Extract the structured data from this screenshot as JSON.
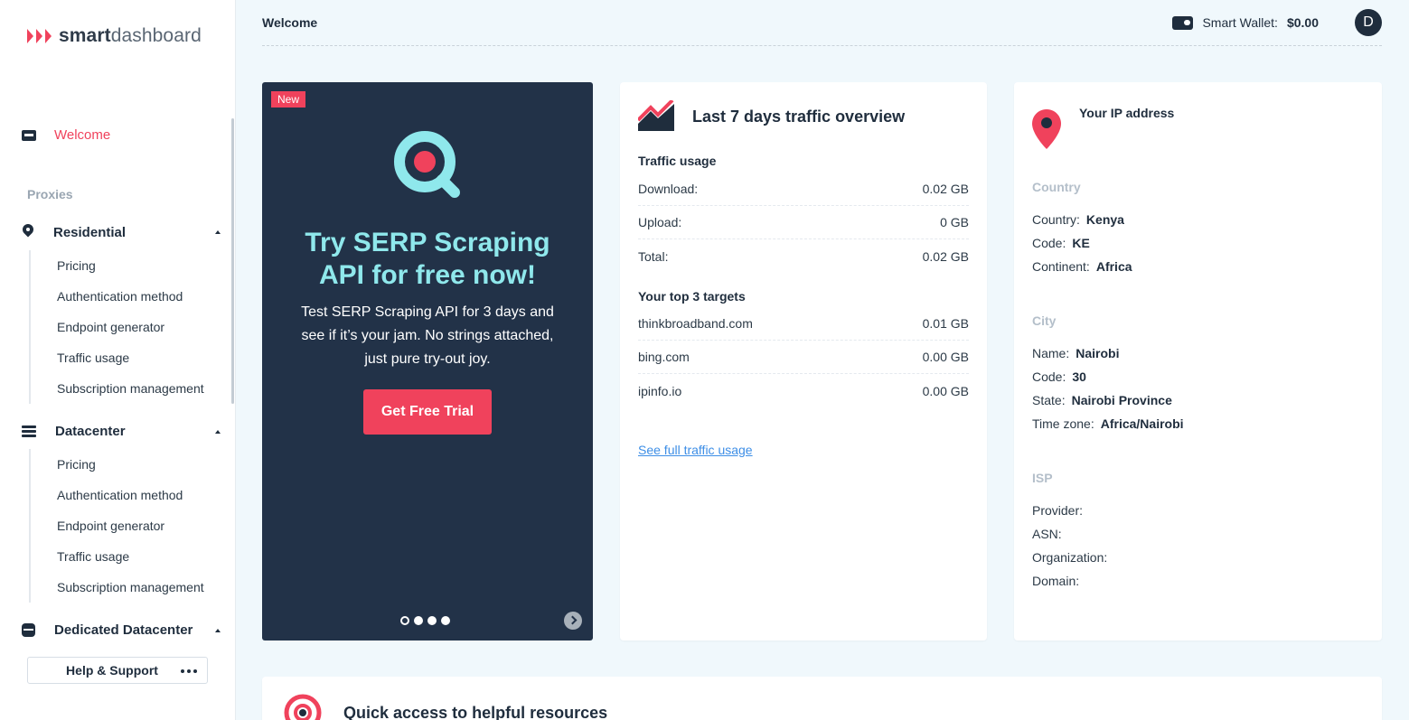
{
  "brand": {
    "logo_bold": "smart",
    "logo_light": "dashboard",
    "accent": "#f0425c",
    "dark": "#223248"
  },
  "sidebar": {
    "welcome": "Welcome",
    "section_title": "Proxies",
    "groups": [
      {
        "label": "Residential",
        "icon": "map-pin-icon",
        "items": [
          "Pricing",
          "Authentication method",
          "Endpoint generator",
          "Traffic usage",
          "Subscription management"
        ]
      },
      {
        "label": "Datacenter",
        "icon": "server-icon",
        "items": [
          "Pricing",
          "Authentication method",
          "Endpoint generator",
          "Traffic usage",
          "Subscription management"
        ]
      },
      {
        "label": "Dedicated Datacenter",
        "icon": "database-icon",
        "items": []
      }
    ],
    "help_label": "Help & Support"
  },
  "header": {
    "title": "Welcome",
    "wallet_label": "Smart Wallet:",
    "wallet_amount": "$0.00",
    "avatar_initial": "D"
  },
  "promo": {
    "badge": "New",
    "title": "Try SERP Scraping API for free now!",
    "text": "Test SERP Scraping API for 3 days and see if it’s your jam. No strings attached, just pure try-out joy.",
    "button": "Get Free Trial",
    "slides": 4,
    "active_slide": 0
  },
  "traffic": {
    "title": "Last 7 days traffic overview",
    "usage_heading": "Traffic usage",
    "usage": [
      {
        "label": "Download:",
        "value": "0.02 GB"
      },
      {
        "label": "Upload:",
        "value": "0 GB"
      },
      {
        "label": "Total:",
        "value": "0.02 GB"
      }
    ],
    "targets_heading": "Your top 3 targets",
    "targets": [
      {
        "label": "thinkbroadband.com",
        "value": "0.01 GB"
      },
      {
        "label": "bing.com",
        "value": "0.00 GB"
      },
      {
        "label": "ipinfo.io",
        "value": "0.00 GB"
      }
    ],
    "link": "See full traffic usage"
  },
  "ip": {
    "title": "Your IP address",
    "country_heading": "Country",
    "country": [
      {
        "label": "Country:",
        "value": "Kenya"
      },
      {
        "label": "Code:",
        "value": "KE"
      },
      {
        "label": "Continent:",
        "value": "Africa"
      }
    ],
    "city_heading": "City",
    "city": [
      {
        "label": "Name:",
        "value": "Nairobi"
      },
      {
        "label": "Code:",
        "value": "30"
      },
      {
        "label": "State:",
        "value": "Nairobi Province"
      },
      {
        "label": "Time zone:",
        "value": "Africa/Nairobi"
      }
    ],
    "isp_heading": "ISP",
    "isp": [
      {
        "label": "Provider:",
        "value": ""
      },
      {
        "label": "ASN:",
        "value": ""
      },
      {
        "label": "Organization:",
        "value": ""
      },
      {
        "label": "Domain:",
        "value": ""
      }
    ]
  },
  "quick": {
    "title": "Quick access to helpful resources"
  }
}
